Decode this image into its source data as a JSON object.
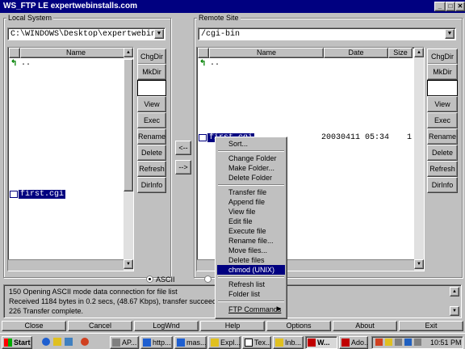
{
  "window": {
    "title": "WS_FTP LE expertwebinstalls.com"
  },
  "local": {
    "label": "Local System",
    "path": "C:\\WINDOWS\\Desktop\\expertwebins",
    "col_name": "Name",
    "up": "..",
    "files": [
      "first.cgi"
    ],
    "buttons": [
      "ChgDir",
      "MkDir",
      "View",
      "Exec",
      "Rename",
      "Delete",
      "Refresh",
      "DirInfo"
    ]
  },
  "transfer": {
    "to_local": "<--",
    "to_remote": "-->"
  },
  "remote": {
    "label": "Remote Site",
    "path": "/cgi-bin",
    "col_name": "Name",
    "col_date": "Date",
    "col_size": "Size",
    "up": "..",
    "file": {
      "name": "first.cgi",
      "date": "20030411 05:34",
      "size": "1"
    },
    "buttons": [
      "ChgDir",
      "MkDir",
      "View",
      "Exec",
      "Rename",
      "Delete",
      "Refresh",
      "DirInfo"
    ]
  },
  "mode": {
    "ascii": "ASCII"
  },
  "context_menu": {
    "items": [
      "Sort...",
      "Change Folder",
      "Make Folder...",
      "Delete Folder",
      "Transfer file",
      "Append file",
      "View file",
      "Edit file",
      "Execute file",
      "Rename file...",
      "Move files...",
      "Delete files",
      "chmod (UNIX)",
      "Refresh list",
      "Folder list",
      "FTP Commands"
    ],
    "selected": "chmod (UNIX)"
  },
  "log": {
    "lines": [
      "150 Opening ASCII mode data connection for file list",
      "Received 1184 bytes in 0.2 secs, (48.67 Kbps), transfer succeeded",
      "226 Transfer complete."
    ]
  },
  "bottom_buttons": [
    "Close",
    "Cancel",
    "LogWnd",
    "Help",
    "Options",
    "About",
    "Exit"
  ],
  "taskbar": {
    "start": "Start",
    "tasks": [
      "AP...",
      "http...",
      "mas...",
      "Expl...",
      "Tex...",
      "Inb...",
      "W...",
      "Ado..."
    ],
    "clock": "10:51 PM"
  }
}
